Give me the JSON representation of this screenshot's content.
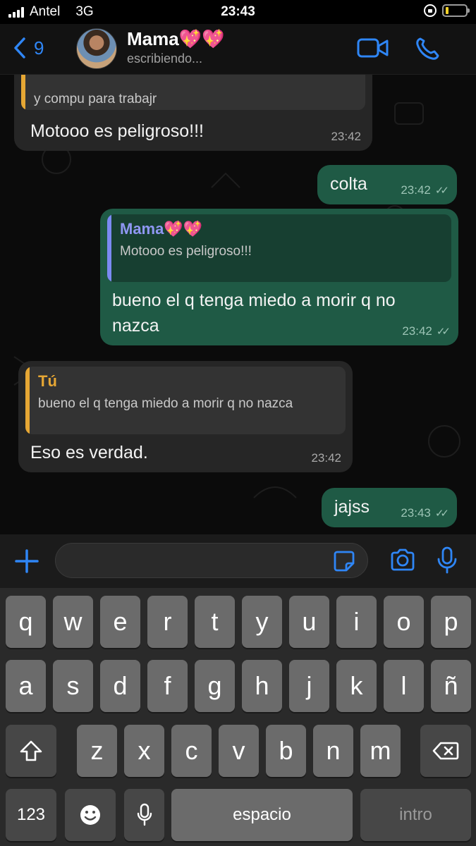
{
  "status_bar": {
    "carrier": "Antel",
    "network": "3G",
    "time": "23:43",
    "battery_level": 0.15
  },
  "header": {
    "back_count": "9",
    "contact_name": "Mama💖💖",
    "contact_status": "escribiendo..."
  },
  "messages": [
    {
      "direction": "in",
      "quote_text_partial": "y compu para trabajr",
      "text": "Motooo es peligroso!!!",
      "time": "23:42"
    },
    {
      "direction": "out",
      "text": "colta",
      "time": "23:42"
    },
    {
      "direction": "out",
      "quote_author": "Mama💖💖",
      "quote_text": "Motooo es peligroso!!!",
      "text_line1": "bueno el q tenga miedo a morir q no",
      "text_line2": "nazca",
      "time": "23:42"
    },
    {
      "direction": "in",
      "quote_author": "Tú",
      "quote_text": "bueno el q tenga miedo a morir q no nazca",
      "text": "Eso es verdad.",
      "time": "23:42"
    },
    {
      "direction": "out",
      "text": "jajss",
      "time": "23:43"
    }
  ],
  "input": {
    "placeholder": ""
  },
  "keyboard": {
    "row1": [
      "q",
      "w",
      "e",
      "r",
      "t",
      "y",
      "u",
      "i",
      "o",
      "p"
    ],
    "row2": [
      "a",
      "s",
      "d",
      "f",
      "g",
      "h",
      "j",
      "k",
      "l",
      "ñ"
    ],
    "row3": [
      "z",
      "x",
      "c",
      "v",
      "b",
      "n",
      "m"
    ],
    "numbers": "123",
    "space": "espacio",
    "return": "intro"
  },
  "colors": {
    "accent": "#2f86f6",
    "outgoing": "#1f5a45",
    "incoming": "#262626",
    "quote_in_bar": "#e6a734",
    "quote_out_bar": "#7c8af2"
  }
}
